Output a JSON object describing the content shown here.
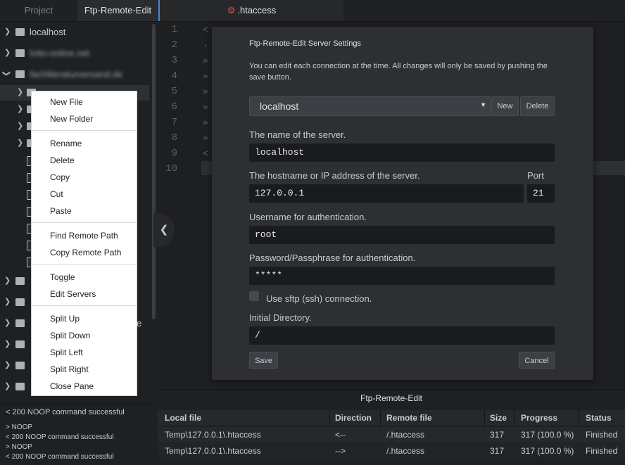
{
  "tabs": {
    "project": "Project",
    "ftp": "Ftp-Remote-Edit",
    "file": ".htaccess"
  },
  "tree": {
    "items": [
      "localhost",
      "lotto-online.net",
      "fachliteraturversand.de"
    ],
    "partial_suffix": "e"
  },
  "editor": {
    "line_numbers": [
      "1",
      "2",
      "3",
      "4",
      "5",
      "6",
      "7",
      "8",
      "9",
      "10"
    ],
    "line_markers": [
      "<",
      "·",
      "»",
      "»",
      "»",
      "»",
      "»",
      "»",
      "<",
      ""
    ]
  },
  "context_menu": {
    "groups": [
      [
        "New File",
        "New Folder"
      ],
      [
        "Rename",
        "Delete",
        "Copy",
        "Cut",
        "Paste"
      ],
      [
        "Find Remote Path",
        "Copy Remote Path"
      ],
      [
        "Toggle",
        "Edit Servers"
      ],
      [
        "Split Up",
        "Split Down",
        "Split Left",
        "Split Right",
        "Close Pane"
      ]
    ]
  },
  "dialog": {
    "title": "Ftp-Remote-Edit Server Settings",
    "description": "You can edit each connection at the time. All changes will only be saved by pushing the save button.",
    "server_select": "localhost",
    "new_label": "New",
    "delete_label": "Delete",
    "name_label": "The name of the server.",
    "name_value": "localhost",
    "host_label": "The hostname or IP address of the server.",
    "host_value": "127.0.0.1",
    "port_label": "Port",
    "port_value": "21",
    "user_label": "Username for authentication.",
    "user_value": "root",
    "pass_label": "Password/Passphrase for authentication.",
    "pass_value": "*****",
    "sftp_label": "Use sftp (ssh) connection.",
    "sftp_checked": false,
    "dir_label": "Initial Directory.",
    "dir_value": "/",
    "save_label": "Save",
    "cancel_label": "Cancel"
  },
  "log": {
    "lines": [
      "< 200 NOOP command successful",
      "> NOOP",
      "< 200 NOOP command successful",
      "> NOOP",
      "< 200 NOOP command successful"
    ]
  },
  "queue": {
    "title": "Ftp-Remote-Edit",
    "headers": [
      "Local file",
      "Direction",
      "Remote file",
      "Size",
      "Progress",
      "Status"
    ],
    "rows": [
      [
        "Temp\\127.0.0.1\\.htaccess",
        "<--",
        "/.htaccess",
        "317",
        "317 (100.0 %)",
        "Finished"
      ],
      [
        "Temp\\127.0.0.1\\.htaccess",
        "-->",
        "/.htaccess",
        "317",
        "317 (100.0 %)",
        "Finished"
      ]
    ]
  },
  "colors": {
    "accent": "#4a82d8",
    "gear": "#d9534f",
    "menu_bg": "#ffffff"
  }
}
